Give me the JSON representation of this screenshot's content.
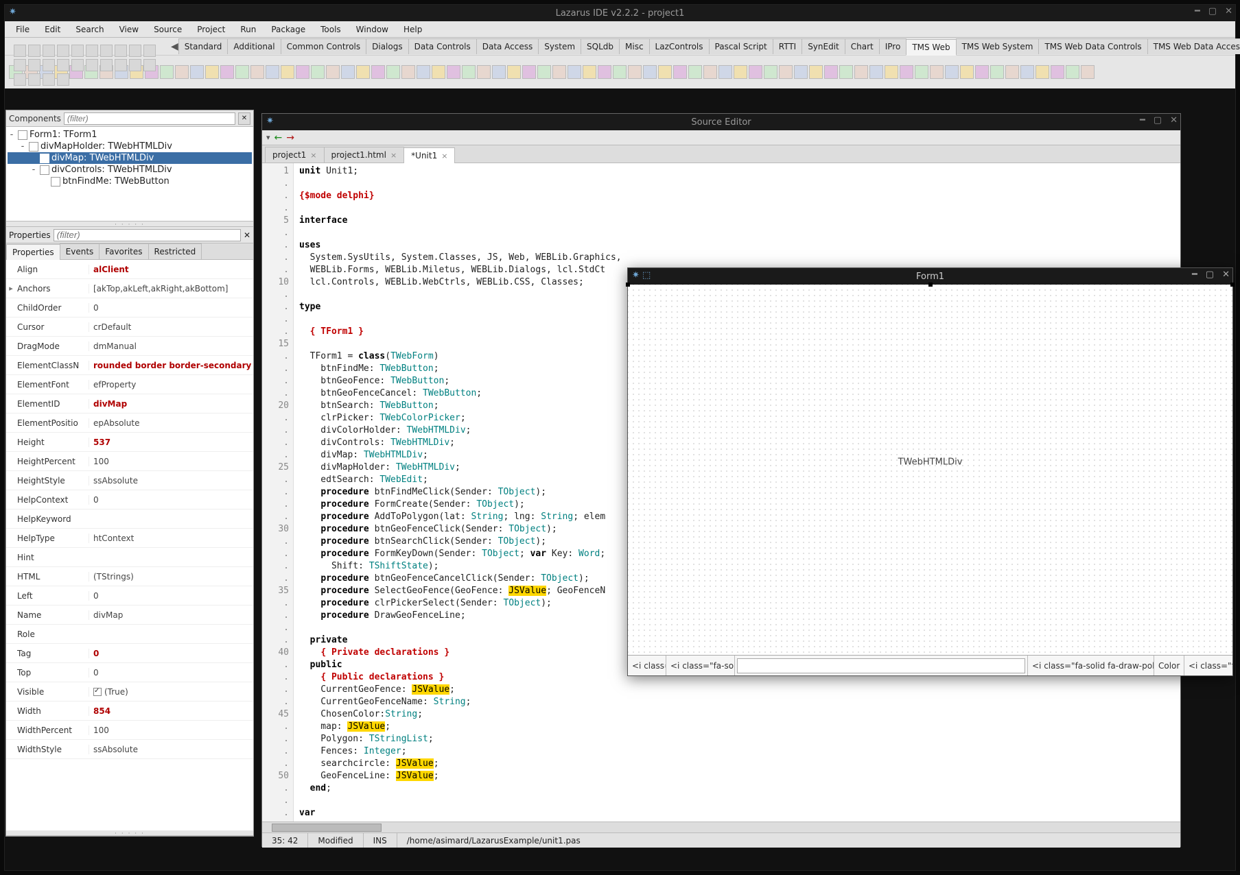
{
  "main_title": "Lazarus IDE v2.2.2 - project1",
  "menus": [
    "File",
    "Edit",
    "Search",
    "View",
    "Source",
    "Project",
    "Run",
    "Package",
    "Tools",
    "Window",
    "Help"
  ],
  "palette_tabs": [
    "Standard",
    "Additional",
    "Common Controls",
    "Dialogs",
    "Data Controls",
    "Data Access",
    "System",
    "SQLdb",
    "Misc",
    "LazControls",
    "Pascal Script",
    "RTTI",
    "SynEdit",
    "Chart",
    "IPro",
    "TMS Web",
    "TMS Web System",
    "TMS Web Data Controls",
    "TMS Web Data Access"
  ],
  "palette_active": "TMS Web",
  "components_label": "Components",
  "filter_placeholder": "(filter)",
  "tree": [
    {
      "depth": 0,
      "toggle": "-",
      "label": "Form1: TForm1",
      "sel": false
    },
    {
      "depth": 1,
      "toggle": "-",
      "label": "divMapHolder: TWebHTMLDiv",
      "sel": false
    },
    {
      "depth": 2,
      "toggle": "",
      "label": "divMap: TWebHTMLDiv",
      "sel": true
    },
    {
      "depth": 2,
      "toggle": "-",
      "label": "divControls: TWebHTMLDiv",
      "sel": false
    },
    {
      "depth": 3,
      "toggle": "",
      "label": "btnFindMe: TWebButton",
      "sel": false
    }
  ],
  "prop_label": "Properties",
  "prop_tabs": [
    "Properties",
    "Events",
    "Favorites",
    "Restricted"
  ],
  "prop_tab_active": "Properties",
  "properties": [
    {
      "exp": "",
      "name": "Align",
      "val": "alClient",
      "red": true
    },
    {
      "exp": "▸",
      "name": "Anchors",
      "val": "[akTop,akLeft,akRight,akBottom]",
      "red": false
    },
    {
      "exp": "",
      "name": "ChildOrder",
      "val": "0",
      "red": false
    },
    {
      "exp": "",
      "name": "Cursor",
      "val": "crDefault",
      "red": false
    },
    {
      "exp": "",
      "name": "DragMode",
      "val": "dmManual",
      "red": false
    },
    {
      "exp": "",
      "name": "ElementClassN",
      "val": "rounded border border-secondary ov",
      "red": true
    },
    {
      "exp": "",
      "name": "ElementFont",
      "val": "efProperty",
      "red": false
    },
    {
      "exp": "",
      "name": "ElementID",
      "val": "divMap",
      "red": true
    },
    {
      "exp": "",
      "name": "ElementPositio",
      "val": "epAbsolute",
      "red": false
    },
    {
      "exp": "",
      "name": "Height",
      "val": "537",
      "red": true
    },
    {
      "exp": "",
      "name": "HeightPercent",
      "val": "100",
      "red": false
    },
    {
      "exp": "",
      "name": "HeightStyle",
      "val": "ssAbsolute",
      "red": false
    },
    {
      "exp": "",
      "name": "HelpContext",
      "val": "0",
      "red": false
    },
    {
      "exp": "",
      "name": "HelpKeyword",
      "val": "",
      "red": false
    },
    {
      "exp": "",
      "name": "HelpType",
      "val": "htContext",
      "red": false
    },
    {
      "exp": "",
      "name": "Hint",
      "val": "",
      "red": false
    },
    {
      "exp": "",
      "name": "HTML",
      "val": "(TStrings)",
      "red": false
    },
    {
      "exp": "",
      "name": "Left",
      "val": "0",
      "red": false
    },
    {
      "exp": "",
      "name": "Name",
      "val": "divMap",
      "red": false
    },
    {
      "exp": "",
      "name": "Role",
      "val": "",
      "red": false
    },
    {
      "exp": "",
      "name": "Tag",
      "val": "0",
      "red": true
    },
    {
      "exp": "",
      "name": "Top",
      "val": "0",
      "red": false
    },
    {
      "exp": "",
      "name": "Visible",
      "val": "(True)",
      "red": false,
      "check": true
    },
    {
      "exp": "",
      "name": "Width",
      "val": "854",
      "red": true
    },
    {
      "exp": "",
      "name": "WidthPercent",
      "val": "100",
      "red": false
    },
    {
      "exp": "",
      "name": "WidthStyle",
      "val": "ssAbsolute",
      "red": false
    }
  ],
  "source_editor": {
    "title": "Source Editor",
    "tabs": [
      {
        "label": "project1",
        "active": false
      },
      {
        "label": "project1.html",
        "active": false
      },
      {
        "label": "*Unit1",
        "active": true
      }
    ],
    "status": {
      "pos": "35: 42",
      "modified": "Modified",
      "mode": "INS",
      "path": "/home/asimard/LazarusExample/unit1.pas"
    }
  },
  "form_designer": {
    "title": "Form1",
    "center_label": "TWebHTMLDiv",
    "row_labels": [
      "<i class=",
      "<i class=\"fa-sol",
      "",
      "<i class=\"fa-solid fa-draw-poly",
      "Color",
      "<i class=\"fa"
    ]
  },
  "code_lines_gutter": [
    "1",
    ".",
    ".",
    ".",
    "5",
    ".",
    ".",
    ".",
    ".",
    "10",
    ".",
    ".",
    ".",
    ".",
    "15",
    ".",
    ".",
    ".",
    ".",
    "20",
    ".",
    ".",
    ".",
    ".",
    "25",
    ".",
    ".",
    ".",
    ".",
    "30",
    ".",
    ".",
    ".",
    ".",
    "35",
    ".",
    ".",
    ".",
    ".",
    "40",
    ".",
    ".",
    ".",
    ".",
    "45",
    ".",
    ".",
    ".",
    ".",
    "50",
    ".",
    ".",
    ".",
    "."
  ]
}
